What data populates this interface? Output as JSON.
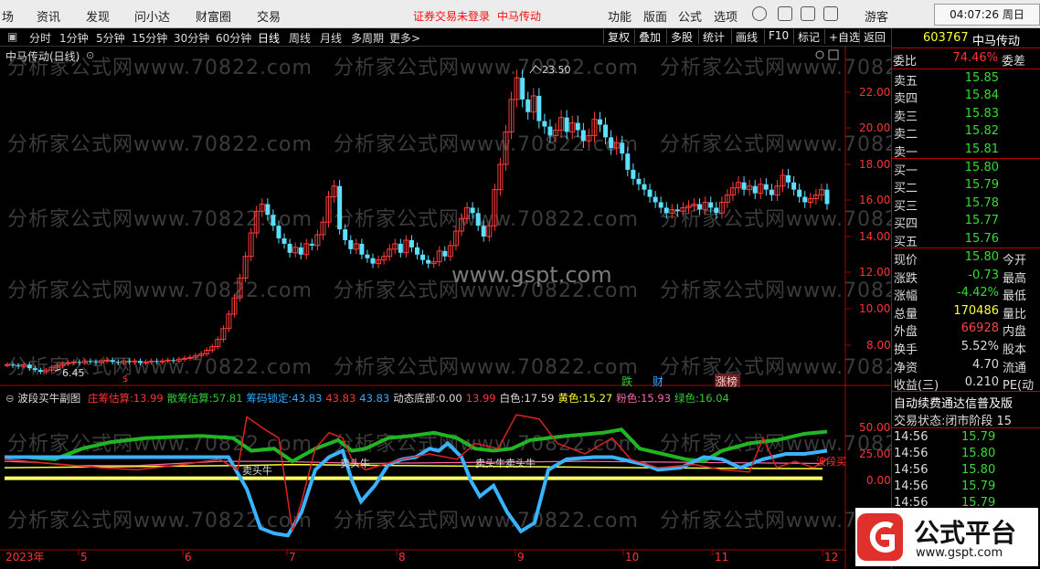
{
  "menu": {
    "items": [
      "场",
      "资讯",
      "发现",
      "问小达",
      "财富圈",
      "交易"
    ],
    "notice": "证券交易未登录",
    "stock_name": "中马传动",
    "right_items": [
      "功能",
      "版面",
      "公式",
      "选项"
    ],
    "guest": "游客",
    "clock": "04:07:26 周日"
  },
  "toolbar": {
    "periods": [
      "分时",
      "1分钟",
      "5分钟",
      "15分钟",
      "30分钟",
      "60分钟",
      "日线",
      "周线",
      "月线",
      "多周期",
      "更多>"
    ],
    "buttons": [
      "复权",
      "叠加",
      "多股",
      "统计",
      "画线",
      "F10",
      "标记",
      "+自选",
      "返回"
    ]
  },
  "chart": {
    "title": "中马传动(日线)",
    "high_label": "23.50",
    "low_label": "6.45",
    "y_ticks": [
      "22.00",
      "20.00",
      "18.00",
      "16.00",
      "14.00",
      "12.00",
      "10.00",
      "8.00"
    ],
    "x_ticks": [
      "2023年",
      "5",
      "6",
      "7",
      "8",
      "9",
      "10",
      "11",
      "12"
    ],
    "markers": [
      "跌",
      "财",
      "涨榜"
    ],
    "watermark": "分析家公式网www.70822.com",
    "gspt": "www.gspt.com"
  },
  "indicator": {
    "name": "波段买牛副图",
    "values": [
      {
        "label": "庄筹估算:",
        "value": "13.99",
        "color": "#ff3333"
      },
      {
        "label": "散筹估算:",
        "value": "57.81",
        "color": "#33cc33"
      },
      {
        "label": "筹码锁定:",
        "value": "43.83",
        "color": "#33aaff"
      },
      {
        "label": "",
        "value": "43.83",
        "color": "#ff3333"
      },
      {
        "label": "",
        "value": "43.83",
        "color": "#33aaff"
      },
      {
        "label": "动态底部:",
        "value": "0.00",
        "color": "#dddddd"
      },
      {
        "label": "",
        "value": "13.99",
        "color": "#ff3333"
      },
      {
        "label": "白色:",
        "value": "17.59",
        "color": "#dddddd"
      },
      {
        "label": "黄色:",
        "value": "15.27",
        "color": "#ffff33"
      },
      {
        "label": "粉色:",
        "value": "15.93",
        "color": "#ff66aa"
      },
      {
        "label": "绿色:",
        "value": "16.04",
        "color": "#33cc33"
      }
    ],
    "y_ticks": [
      "50.00",
      "25.00",
      "0.00"
    ],
    "signal_labels": [
      "卖头牛",
      "卖头牛",
      "卖头牛卖头牛",
      "波段买"
    ]
  },
  "quote": {
    "code": "603767",
    "name": "中马传动",
    "ratio_label": "委比",
    "ratio_value": "74.46%",
    "ratio_right": "委差",
    "asks": [
      {
        "label": "卖五",
        "price": "15.85"
      },
      {
        "label": "卖四",
        "price": "15.84"
      },
      {
        "label": "卖三",
        "price": "15.83"
      },
      {
        "label": "卖二",
        "price": "15.82"
      },
      {
        "label": "卖一",
        "price": "15.81"
      }
    ],
    "bids": [
      {
        "label": "买一",
        "price": "15.80"
      },
      {
        "label": "买二",
        "price": "15.79"
      },
      {
        "label": "买三",
        "price": "15.78"
      },
      {
        "label": "买四",
        "price": "15.77"
      },
      {
        "label": "买五",
        "price": "15.76"
      }
    ],
    "stats": [
      {
        "label": "现价",
        "value": "15.80",
        "right": "今开",
        "color": "#33dd33"
      },
      {
        "label": "涨跌",
        "value": "-0.73",
        "right": "最高",
        "color": "#33dd33"
      },
      {
        "label": "涨幅",
        "value": "-4.42%",
        "right": "最低",
        "color": "#33dd33"
      },
      {
        "label": "总量",
        "value": "170486",
        "right": "量比",
        "color": "#ffff33"
      },
      {
        "label": "外盘",
        "value": "66928",
        "right": "内盘",
        "color": "#ff4444"
      },
      {
        "label": "换手",
        "value": "5.52%",
        "right": "股本",
        "color": "#dddddd"
      },
      {
        "label": "净资",
        "value": "4.70",
        "right": "流通",
        "color": "#dddddd"
      },
      {
        "label": "收益(三)",
        "value": "0.210",
        "right": "PE(动",
        "color": "#dddddd"
      }
    ],
    "notice": "自动续费通达信普及版",
    "status_label": "交易状态:",
    "status_value": "闭市阶段 15",
    "ticks": [
      {
        "time": "14:56",
        "price": "15.79"
      },
      {
        "time": "14:56",
        "price": "15.80"
      },
      {
        "time": "14:56",
        "price": "15.80"
      },
      {
        "time": "14:56",
        "price": "15.79"
      },
      {
        "time": "14:56",
        "price": "15.79"
      }
    ]
  },
  "brand": {
    "name": "公式平台",
    "url": "www.gspt.com"
  }
}
